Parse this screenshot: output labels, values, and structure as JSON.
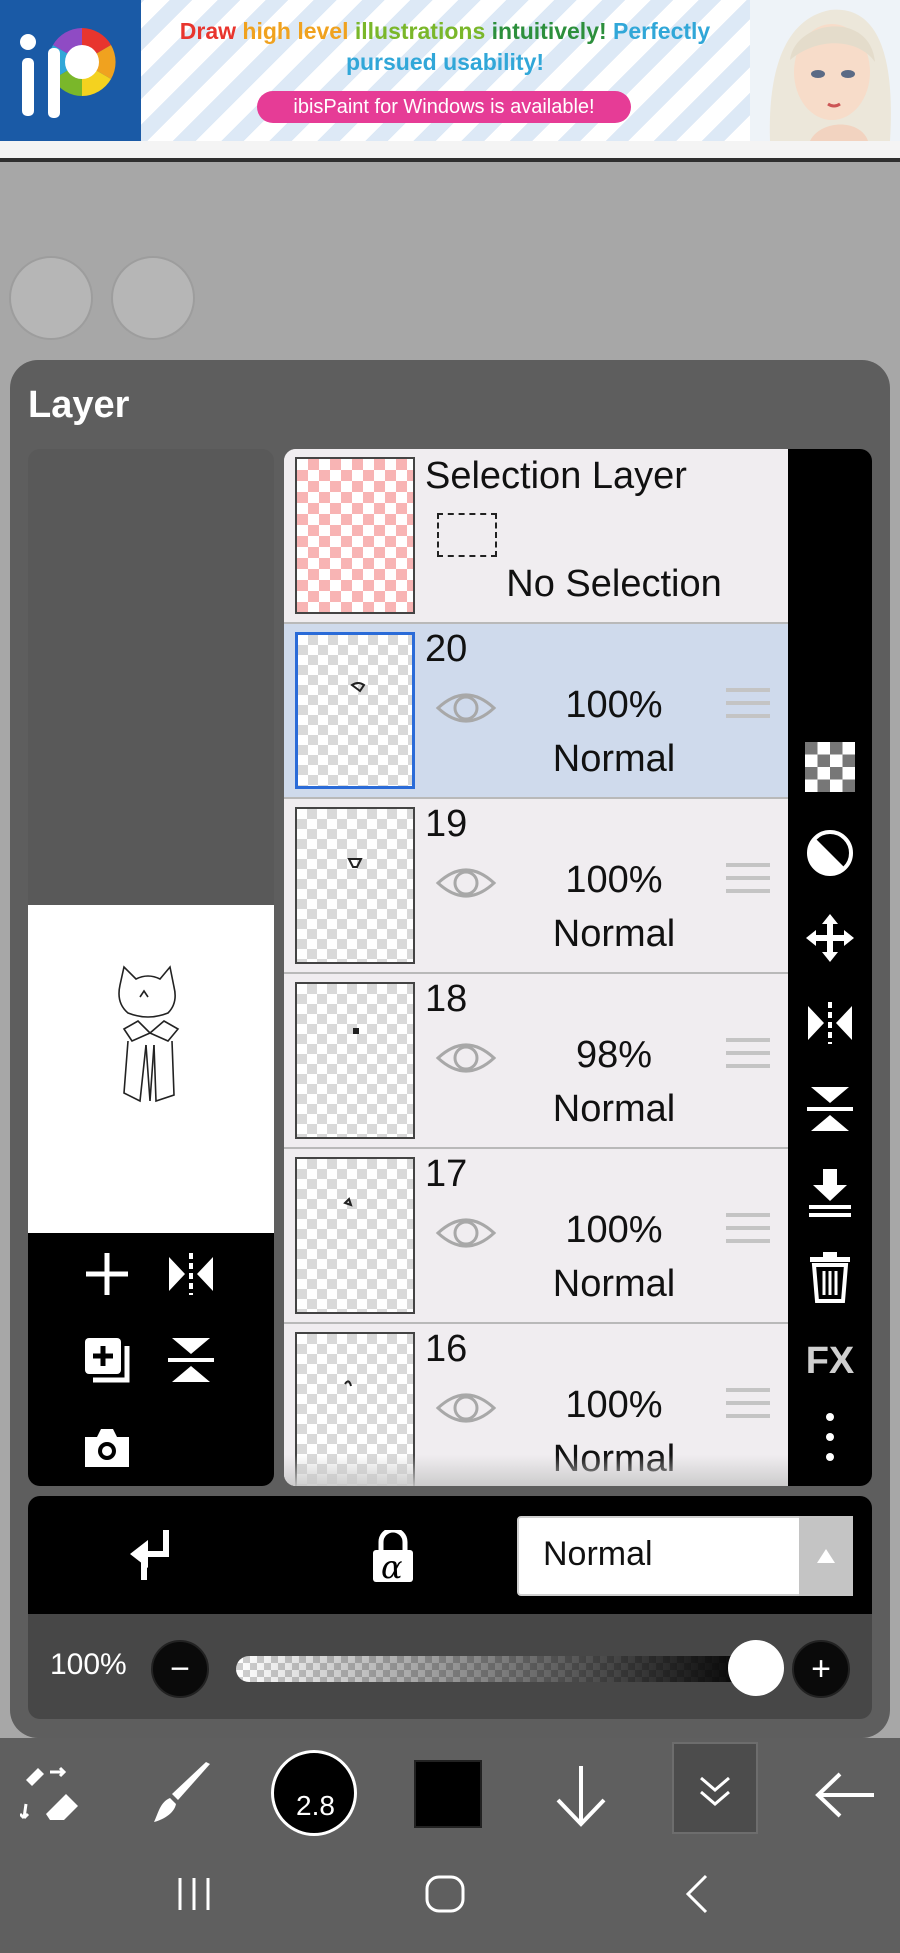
{
  "ad": {
    "headline_words": [
      {
        "text": "Draw",
        "color": "#e8352e"
      },
      {
        "text": "high level",
        "color": "#f0a21f"
      },
      {
        "text": "illustrations",
        "color": "#7ab72a"
      },
      {
        "text": "intuitively!",
        "color": "#2c8f3c"
      },
      {
        "text": "Perfectly",
        "color": "#31a7d8"
      },
      {
        "text": "pursued usability!",
        "color": "#31a7d8"
      }
    ],
    "pill_text": "ibisPaint for Windows is available!",
    "logo_text": "iP"
  },
  "panel": {
    "title": "Layer"
  },
  "selection_layer": {
    "title": "Selection Layer",
    "status": "No Selection"
  },
  "layers": [
    {
      "number": "20",
      "opacity": "100%",
      "blend": "Normal",
      "selected": true
    },
    {
      "number": "19",
      "opacity": "100%",
      "blend": "Normal",
      "selected": false
    },
    {
      "number": "18",
      "opacity": "98%",
      "blend": "Normal",
      "selected": false
    },
    {
      "number": "17",
      "opacity": "100%",
      "blend": "Normal",
      "selected": false
    },
    {
      "number": "16",
      "opacity": "100%",
      "blend": "Normal",
      "selected": false
    }
  ],
  "right_toolbar": {
    "fx_label": "FX",
    "icons": [
      "transparency-grid-icon",
      "invert-circle-icon",
      "move-icon",
      "flip-horizontal-icon",
      "flip-vertical-icon",
      "merge-down-icon",
      "trash-icon",
      "fx-icon",
      "more-icon"
    ]
  },
  "blend_bar": {
    "blend_mode": "Normal",
    "alpha_lock_symbol": "α"
  },
  "opacity_bar": {
    "opacity_label": "100%",
    "opacity_value": 1.0,
    "minus": "−",
    "plus": "+"
  },
  "bottom_toolbar": {
    "brush_size": "2.8",
    "color": "#000000"
  }
}
